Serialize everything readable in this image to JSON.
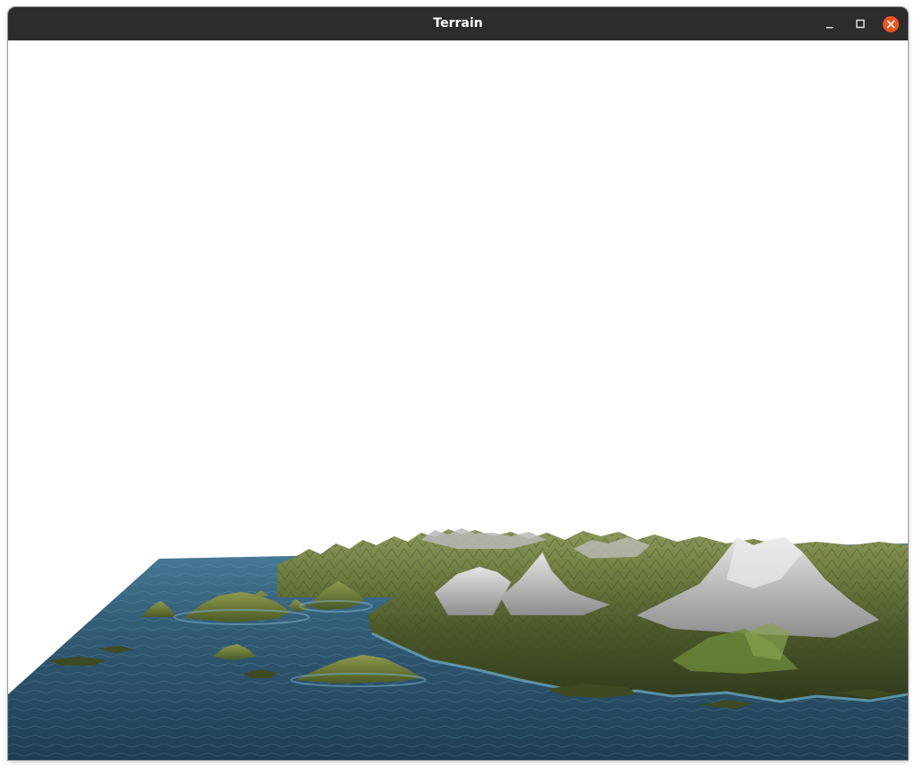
{
  "window": {
    "title": "Terrain",
    "controls": [
      "minimize-icon",
      "maximize-icon",
      "close-icon"
    ],
    "titlebar_color": "#2c2c2c",
    "close_button_color": "#e95420"
  },
  "viewport": {
    "content": "3d-terrain-render",
    "sky_color": "#ffffff",
    "water_color": "#2a4f66",
    "land_color": "#5a6b32",
    "snow_color": "#c8c8c8"
  }
}
